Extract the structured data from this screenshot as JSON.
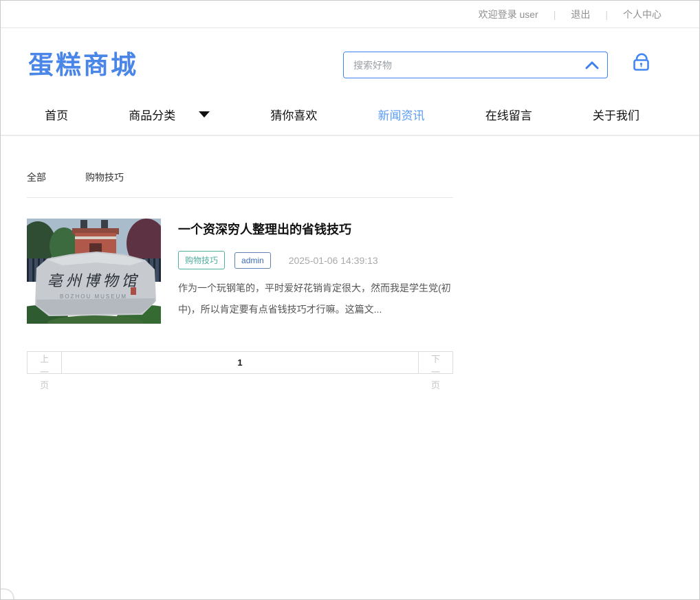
{
  "topbar": {
    "welcome": "欢迎登录 user",
    "sep": "|",
    "logout": "退出",
    "profile": "个人中心"
  },
  "header": {
    "logo_text": "蛋糕商城",
    "search_placeholder": "搜索好物"
  },
  "nav": {
    "items": [
      {
        "label": "首页",
        "active": false
      },
      {
        "label": "商品分类",
        "active": false,
        "has_dropdown": true
      },
      {
        "label": "猜你喜欢",
        "active": false
      },
      {
        "label": "新闻资讯",
        "active": true
      },
      {
        "label": "在线留言",
        "active": false
      },
      {
        "label": "关于我们",
        "active": false
      }
    ]
  },
  "filters": {
    "items": [
      "全部",
      "购物技巧"
    ]
  },
  "news": {
    "item": {
      "title": "一个资深穷人整理出的省钱技巧",
      "tags": [
        {
          "label": "购物技巧",
          "color": "#4fae9e"
        },
        {
          "label": "admin",
          "color": "#3f6db3"
        }
      ],
      "date": "2025-01-06 14:39:13",
      "excerpt": "作为一个玩钢笔的，平时爱好花销肯定很大，然而我是学生党(初中)，所以肯定要有点省钱技巧才行嘛。这篇文...",
      "image": {
        "stone_text": "亳州博物馆",
        "stone_subtext": "BOZHOU MUSEUM"
      }
    }
  },
  "pagination": {
    "prev": "上一页",
    "page": "1",
    "next": "下一页"
  },
  "colors": {
    "logo_blue": "#4a86e8",
    "search_border_blue": "#3d7ff0",
    "nav_active_blue": "#5a9cf8",
    "tag_teal": "#4fae9e",
    "tag_admin_blue": "#3f6db3",
    "date_gray": "#a9a9a9"
  }
}
